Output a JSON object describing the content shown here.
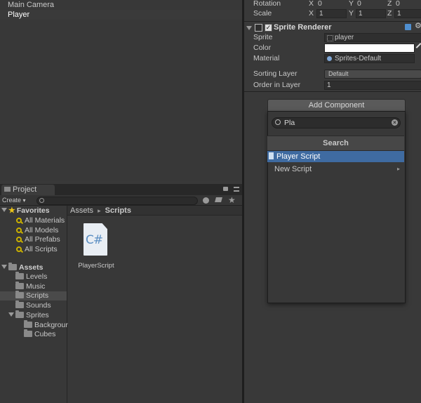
{
  "hierarchy": {
    "items": [
      "Main Camera",
      "Player"
    ]
  },
  "project": {
    "tab_label": "Project",
    "create_label": "Create",
    "create_arrow": "▾",
    "favorites": {
      "label": "Favorites",
      "items": [
        "All Materials",
        "All Models",
        "All Prefabs",
        "All Scripts"
      ]
    },
    "assets": {
      "label": "Assets",
      "folders": [
        "Levels",
        "Music",
        "Scripts",
        "Sounds",
        "Sprites"
      ],
      "sprites_children": [
        "Backgrour",
        "Cubes"
      ]
    },
    "breadcrumb": {
      "root": "Assets",
      "sep": "▸",
      "current": "Scripts"
    },
    "file": {
      "name": "PlayerScript",
      "glyph": "C#"
    }
  },
  "inspector": {
    "rotation": {
      "label": "Rotation",
      "x": "0",
      "y": "0",
      "z": "0"
    },
    "scale": {
      "label": "Scale",
      "x": "1",
      "y": "1",
      "z": "1"
    },
    "axis": {
      "x": "X",
      "y": "Y",
      "z": "Z"
    },
    "sprite_renderer": {
      "title": "Sprite Renderer",
      "sprite_label": "Sprite",
      "sprite_value": "player",
      "color_label": "Color",
      "material_label": "Material",
      "material_value": "Sprites-Default",
      "sorting_layer_label": "Sorting Layer",
      "sorting_layer_value": "Default",
      "order_label": "Order in Layer",
      "order_value": "1"
    }
  },
  "add_component": {
    "button_label": "Add Component",
    "search_value": "Pla",
    "header": "Search",
    "items": [
      "Player Script",
      "New Script"
    ],
    "submenu_arrow": "▸"
  },
  "colors": {
    "selection": "#3f6ba1",
    "favorites_star": "#e8c21a",
    "search_icon": "#c9b000"
  }
}
